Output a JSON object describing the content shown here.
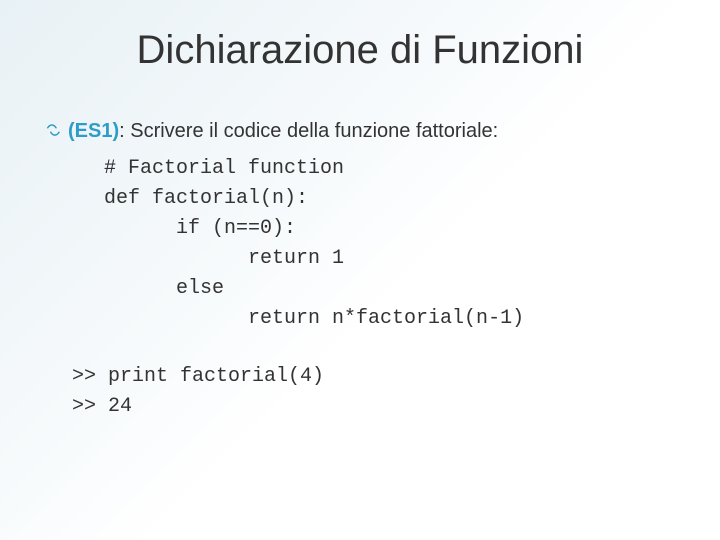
{
  "title": "Dichiarazione di Funzioni",
  "bullet": {
    "glyph": "་",
    "label": "(ES1)",
    "text": ": Scrivere il codice della funzione fattoriale:"
  },
  "code": [
    "# Factorial function",
    "def factorial(n):",
    "      if (n==0):",
    "            return 1",
    "      else",
    "            return n*factorial(n-1)"
  ],
  "output": [
    ">> print factorial(4)",
    ">> 24"
  ]
}
